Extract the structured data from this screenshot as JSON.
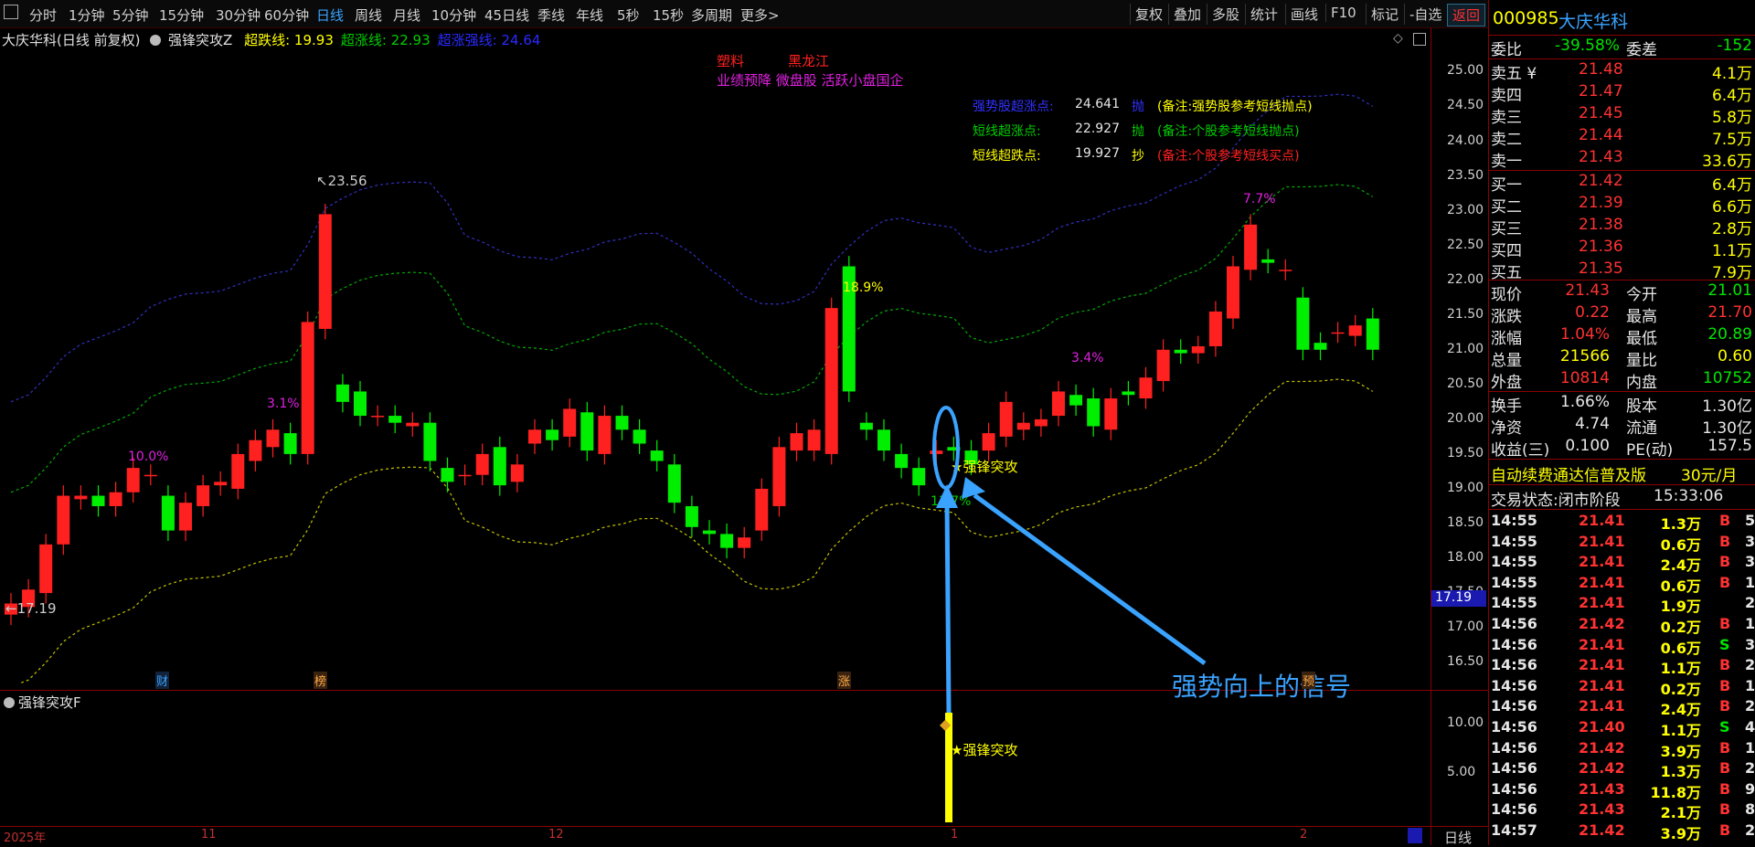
{
  "toolbar": {
    "menu_icon": "square-icon",
    "periods": [
      "分时",
      "1分钟",
      "5分钟",
      "15分钟",
      "30分钟",
      "60分钟",
      "日线",
      "周线",
      "月线",
      "10分钟",
      "45日线",
      "季线",
      "年线",
      "5秒",
      "15秒",
      "多周期",
      "更多>"
    ],
    "active_period": "日线",
    "right_buttons": [
      "复权",
      "叠加",
      "多股",
      "统计",
      "画线",
      "F10",
      "标记",
      "-自选",
      "返回"
    ]
  },
  "chart": {
    "stock_title": "大庆华科(日线 前复权)",
    "indicator_name": "强锋突攻Z",
    "lines": [
      {
        "label": "超跌线:",
        "value": "19.93",
        "color": "#ffff00"
      },
      {
        "label": "超涨线:",
        "value": "22.93",
        "color": "#00cc00"
      },
      {
        "label": "超涨强线:",
        "value": "24.64",
        "color": "#2a2aff"
      }
    ],
    "tags": {
      "row1": [
        "塑料",
        "黑龙江"
      ],
      "row2": "业绩预降 微盘股 活跃小盘国企"
    },
    "info_rows": [
      {
        "label": "强势股超涨点:",
        "value": "24.641",
        "action": "抛",
        "note": "(备注:强势股参考短线抛点)",
        "color": "#3030ff",
        "note_color": "#ffff00"
      },
      {
        "label": "短线超涨点:",
        "value": "22.927",
        "action": "抛",
        "note": "(备注:个股参考短线抛点)",
        "color": "#00cc00",
        "note_color": "#00cc00"
      },
      {
        "label": "短线超跌点:",
        "value": "19.927",
        "action": "抄",
        "note": "(备注:个股参考短线买点)",
        "color": "#ffff00",
        "note_color": "#ff2020"
      }
    ],
    "y_axis": [
      "25.00",
      "24.50",
      "24.00",
      "23.50",
      "23.00",
      "22.50",
      "22.00",
      "21.50",
      "21.00",
      "20.50",
      "20.00",
      "19.50",
      "19.00",
      "18.50",
      "18.00",
      "17.50",
      "17.00",
      "16.50"
    ],
    "current_price_tag": "17.19",
    "annotations": {
      "high_label": "23.56",
      "low_label": "17.19",
      "pct_labels": [
        "10.0%",
        "3.1%",
        "18.9%",
        "3.4%",
        "7.7%",
        "13.7%"
      ],
      "signal_text": "强锋突攻",
      "callout": "强势向上的信号",
      "event_badges": [
        "财",
        "榜",
        "涨",
        "预"
      ]
    },
    "sub_indicator": "强锋突攻F",
    "sub_y_axis": [
      "10.00",
      "5.00"
    ],
    "sub_signal": "强锋突攻",
    "x_axis": [
      "2025年",
      "11",
      "12",
      "1",
      "2"
    ],
    "x_period": "日线"
  },
  "chart_data": {
    "type": "candlestick",
    "title": "大庆华科(日线 前复权)",
    "ylim": [
      16.2,
      25.4
    ],
    "candles": [
      {
        "o": 17.19,
        "c": 17.35
      },
      {
        "o": 17.3,
        "c": 17.55
      },
      {
        "o": 17.5,
        "c": 18.2
      },
      {
        "o": 18.2,
        "c": 18.9
      },
      {
        "o": 18.85,
        "c": 18.9
      },
      {
        "o": 18.9,
        "c": 18.75
      },
      {
        "o": 18.75,
        "c": 18.95
      },
      {
        "o": 18.95,
        "c": 19.3
      },
      {
        "o": 19.2,
        "c": 19.2
      },
      {
        "o": 18.9,
        "c": 18.4
      },
      {
        "o": 18.4,
        "c": 18.8
      },
      {
        "o": 18.75,
        "c": 19.05
      },
      {
        "o": 19.05,
        "c": 19.1
      },
      {
        "o": 19.0,
        "c": 19.5
      },
      {
        "o": 19.4,
        "c": 19.7
      },
      {
        "o": 19.6,
        "c": 19.85
      },
      {
        "o": 19.8,
        "c": 19.5
      },
      {
        "o": 19.5,
        "c": 21.4
      },
      {
        "o": 21.3,
        "c": 22.95
      },
      {
        "o": 20.5,
        "c": 20.25
      },
      {
        "o": 20.4,
        "c": 20.05
      },
      {
        "o": 20.05,
        "c": 20.05
      },
      {
        "o": 20.05,
        "c": 19.95
      },
      {
        "o": 19.9,
        "c": 19.95
      },
      {
        "o": 19.95,
        "c": 19.4
      },
      {
        "o": 19.3,
        "c": 19.1
      },
      {
        "o": 19.2,
        "c": 19.2
      },
      {
        "o": 19.2,
        "c": 19.5
      },
      {
        "o": 19.6,
        "c": 19.05
      },
      {
        "o": 19.1,
        "c": 19.35
      },
      {
        "o": 19.65,
        "c": 19.85
      },
      {
        "o": 19.85,
        "c": 19.7
      },
      {
        "o": 19.75,
        "c": 20.15
      },
      {
        "o": 20.1,
        "c": 19.55
      },
      {
        "o": 19.5,
        "c": 20.05
      },
      {
        "o": 20.05,
        "c": 19.85
      },
      {
        "o": 19.85,
        "c": 19.65
      },
      {
        "o": 19.55,
        "c": 19.4
      },
      {
        "o": 19.35,
        "c": 18.8
      },
      {
        "o": 18.75,
        "c": 18.45
      },
      {
        "o": 18.4,
        "c": 18.35
      },
      {
        "o": 18.35,
        "c": 18.15
      },
      {
        "o": 18.15,
        "c": 18.3
      },
      {
        "o": 18.4,
        "c": 19.0
      },
      {
        "o": 18.75,
        "c": 19.6
      },
      {
        "o": 19.55,
        "c": 19.8
      },
      {
        "o": 19.55,
        "c": 19.85
      },
      {
        "o": 19.5,
        "c": 21.6
      },
      {
        "o": 22.2,
        "c": 20.4
      },
      {
        "o": 19.95,
        "c": 19.85
      },
      {
        "o": 19.85,
        "c": 19.55
      },
      {
        "o": 19.5,
        "c": 19.3
      },
      {
        "o": 19.3,
        "c": 19.05
      },
      {
        "o": 19.5,
        "c": 19.55
      },
      {
        "o": 19.6,
        "c": 19.55
      },
      {
        "o": 19.55,
        "c": 19.35
      },
      {
        "o": 19.55,
        "c": 19.8
      },
      {
        "o": 19.75,
        "c": 20.25
      },
      {
        "o": 19.85,
        "c": 19.95
      },
      {
        "o": 19.9,
        "c": 20.0
      },
      {
        "o": 20.05,
        "c": 20.4
      },
      {
        "o": 20.35,
        "c": 20.2
      },
      {
        "o": 20.3,
        "c": 19.9
      },
      {
        "o": 19.85,
        "c": 20.3
      },
      {
        "o": 20.4,
        "c": 20.35
      },
      {
        "o": 20.3,
        "c": 20.6
      },
      {
        "o": 20.55,
        "c": 21.0
      },
      {
        "o": 21.0,
        "c": 20.95
      },
      {
        "o": 20.95,
        "c": 21.05
      },
      {
        "o": 21.05,
        "c": 21.55
      },
      {
        "o": 21.45,
        "c": 22.2
      },
      {
        "o": 22.15,
        "c": 22.8
      },
      {
        "o": 22.3,
        "c": 22.25
      },
      {
        "o": 22.15,
        "c": 22.15
      },
      {
        "o": 21.75,
        "c": 21.0
      },
      {
        "o": 21.1,
        "c": 21.0
      },
      {
        "o": 21.25,
        "c": 21.25
      },
      {
        "o": 21.2,
        "c": 21.35
      },
      {
        "o": 21.45,
        "c": 21.0
      }
    ]
  },
  "quote": {
    "code": "000985",
    "name": "大庆华科",
    "weibi_label": "委比",
    "weibi": "-39.58%",
    "weicha_label": "委差",
    "weicha": "-152",
    "asks": [
      {
        "label": "卖五 ¥",
        "price": "21.48",
        "vol": "4.1万"
      },
      {
        "label": "卖四",
        "price": "21.47",
        "vol": "6.4万"
      },
      {
        "label": "卖三",
        "price": "21.45",
        "vol": "5.8万"
      },
      {
        "label": "卖二",
        "price": "21.44",
        "vol": "7.5万"
      },
      {
        "label": "卖一",
        "price": "21.43",
        "vol": "33.6万"
      }
    ],
    "bids": [
      {
        "label": "买一",
        "price": "21.42",
        "vol": "6.4万"
      },
      {
        "label": "买二",
        "price": "21.39",
        "vol": "6.6万"
      },
      {
        "label": "买三",
        "price": "21.38",
        "vol": "2.8万"
      },
      {
        "label": "买四",
        "price": "21.36",
        "vol": "1.1万"
      },
      {
        "label": "买五",
        "price": "21.35",
        "vol": "7.9万"
      }
    ],
    "stats": [
      {
        "l1": "现价",
        "v1": "21.43",
        "c1": "red",
        "l2": "今开",
        "v2": "21.01",
        "c2": "green"
      },
      {
        "l1": "涨跌",
        "v1": "0.22",
        "c1": "red",
        "l2": "最高",
        "v2": "21.70",
        "c2": "red"
      },
      {
        "l1": "涨幅",
        "v1": "1.04%",
        "c1": "red",
        "l2": "最低",
        "v2": "20.89",
        "c2": "green"
      },
      {
        "l1": "总量",
        "v1": "21566",
        "c1": "yel",
        "l2": "量比",
        "v2": "0.60",
        "c2": "yel"
      },
      {
        "l1": "外盘",
        "v1": "10814",
        "c1": "red",
        "l2": "内盘",
        "v2": "10752",
        "c2": "green"
      }
    ],
    "stats2": [
      {
        "l1": "换手",
        "v1": "1.66%",
        "l2": "股本",
        "v2": "1.30亿"
      },
      {
        "l1": "净资",
        "v1": "4.74",
        "l2": "流通",
        "v2": "1.30亿"
      },
      {
        "l1": "收益(三)",
        "v1": "0.100",
        "l2": "PE(动)",
        "v2": "157.5"
      }
    ],
    "ad_text": "自动续费通达信普及版",
    "ad_price": "30元/月",
    "trade_status": "交易状态:闭市阶段",
    "trade_time": "15:33:06",
    "ticks": [
      {
        "t": "14:55",
        "p": "21.41",
        "v": "1.3万",
        "s": "B",
        "n": "5"
      },
      {
        "t": "14:55",
        "p": "21.41",
        "v": "0.6万",
        "s": "B",
        "n": "3"
      },
      {
        "t": "14:55",
        "p": "21.41",
        "v": "2.4万",
        "s": "B",
        "n": "3"
      },
      {
        "t": "14:55",
        "p": "21.41",
        "v": "0.6万",
        "s": "B",
        "n": "1"
      },
      {
        "t": "14:55",
        "p": "21.41",
        "v": "1.9万",
        "s": "",
        "n": "2"
      },
      {
        "t": "14:56",
        "p": "21.42",
        "v": "0.2万",
        "s": "B",
        "n": "1"
      },
      {
        "t": "14:56",
        "p": "21.41",
        "v": "0.6万",
        "s": "S",
        "n": "3"
      },
      {
        "t": "14:56",
        "p": "21.41",
        "v": "1.1万",
        "s": "B",
        "n": "2"
      },
      {
        "t": "14:56",
        "p": "21.41",
        "v": "0.2万",
        "s": "B",
        "n": "1"
      },
      {
        "t": "14:56",
        "p": "21.41",
        "v": "2.4万",
        "s": "B",
        "n": "2"
      },
      {
        "t": "14:56",
        "p": "21.40",
        "v": "1.1万",
        "s": "S",
        "n": "4"
      },
      {
        "t": "14:56",
        "p": "21.42",
        "v": "3.9万",
        "s": "B",
        "n": "1"
      },
      {
        "t": "14:56",
        "p": "21.42",
        "v": "1.3万",
        "s": "B",
        "n": "2"
      },
      {
        "t": "14:56",
        "p": "21.43",
        "v": "11.8万",
        "s": "B",
        "n": "9"
      },
      {
        "t": "14:56",
        "p": "21.43",
        "v": "2.1万",
        "s": "B",
        "n": "8"
      },
      {
        "t": "14:57",
        "p": "21.42",
        "v": "3.9万",
        "s": "B",
        "n": "2"
      }
    ]
  }
}
